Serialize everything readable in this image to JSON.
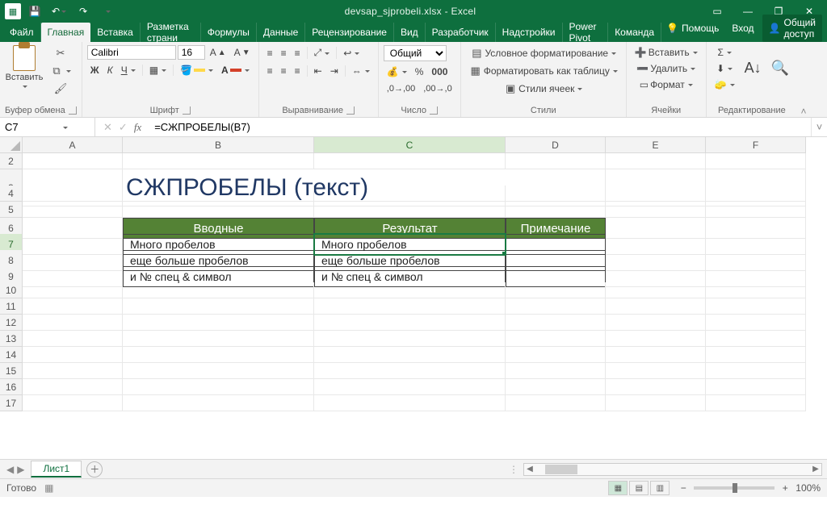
{
  "app": {
    "title": "devsap_sjprobeli.xlsx - Excel"
  },
  "qat": {
    "save": "✓",
    "undo": "↶",
    "redo": "↷"
  },
  "tabs": {
    "file": "Файл",
    "home": "Главная",
    "insert": "Вставка",
    "layout": "Разметка страни",
    "formulas": "Формулы",
    "data": "Данные",
    "review": "Рецензирование",
    "view": "Вид",
    "developer": "Разработчик",
    "addins": "Надстройки",
    "powerpivot": "Power Pivot",
    "team": "Команда",
    "help": "Помощь",
    "login": "Вход",
    "share": "Общий доступ"
  },
  "ribbon": {
    "clipboard": {
      "paste": "Вставить",
      "group": "Буфер обмена"
    },
    "font": {
      "name": "Calibri",
      "size": "16",
      "bold": "Ж",
      "italic": "К",
      "underline": "Ч",
      "group": "Шрифт"
    },
    "align": {
      "wrap": "",
      "merge": "",
      "group": "Выравнивание"
    },
    "number": {
      "format": "Общий",
      "group": "Число"
    },
    "styles": {
      "cond": "Условное форматирование",
      "table": "Форматировать как таблицу",
      "cell": "Стили ячеек",
      "group": "Стили"
    },
    "cells": {
      "insert": "Вставить",
      "delete": "Удалить",
      "format": "Формат",
      "group": "Ячейки"
    },
    "editing": {
      "group": "Редактирование"
    }
  },
  "formula_bar": {
    "cell_ref": "C7",
    "formula": "=СЖПРОБЕЛЫ(B7)"
  },
  "columns": [
    "A",
    "B",
    "C",
    "D",
    "E",
    "F"
  ],
  "sheet": {
    "title": "СЖПРОБЕЛЫ (текст)",
    "headers": {
      "input": "Вводные",
      "result": "Результат",
      "note": "Примечание"
    },
    "rows": [
      {
        "b": "Много     пробелов",
        "c": "Много пробелов"
      },
      {
        "b": "еще   больше   пробелов",
        "c": "еще больше пробелов"
      },
      {
        "b": "  и    № спец   &   символ",
        "c": "и № спец & символ"
      }
    ]
  },
  "sheet_tab": "Лист1",
  "status": {
    "ready": "Готово",
    "zoom": "100%"
  }
}
